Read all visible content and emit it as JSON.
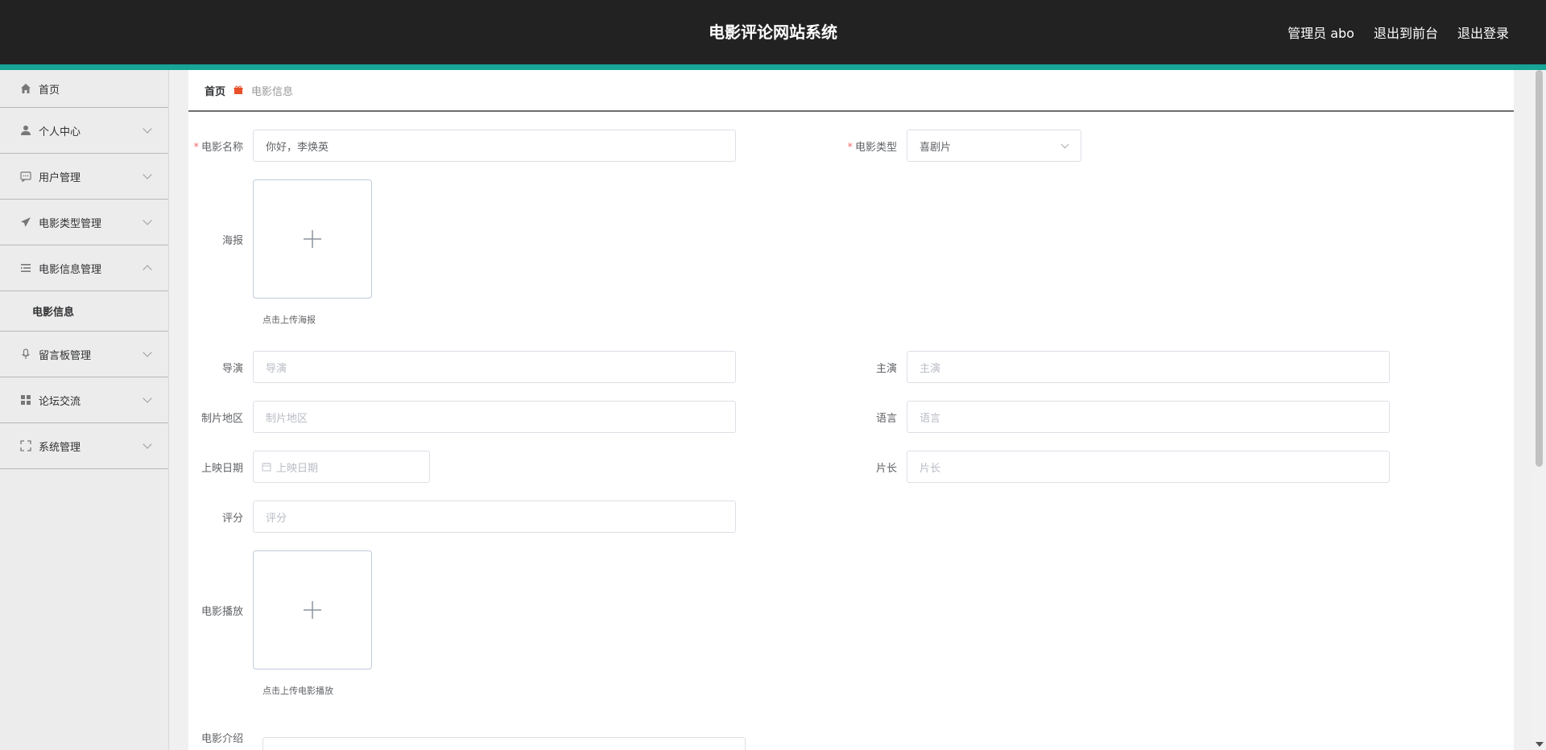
{
  "header": {
    "title": "电影评论网站系统",
    "user": "管理员 abo",
    "front_link": "退出到前台",
    "logout": "退出登录"
  },
  "sidebar": {
    "items": [
      {
        "label": "首页",
        "icon": "home-icon"
      },
      {
        "label": "个人中心",
        "icon": "user-icon"
      },
      {
        "label": "用户管理",
        "icon": "chat-icon"
      },
      {
        "label": "电影类型管理",
        "icon": "send-icon"
      },
      {
        "label": "电影信息管理",
        "icon": "list-icon",
        "expanded": true
      },
      {
        "label": "留言板管理",
        "icon": "microphone-icon"
      },
      {
        "label": "论坛交流",
        "icon": "grid-icon"
      },
      {
        "label": "系统管理",
        "icon": "fullscreen-icon"
      }
    ],
    "submenu": {
      "label": "电影信息"
    }
  },
  "breadcrumb": {
    "home": "首页",
    "current": "电影信息"
  },
  "form": {
    "name": {
      "label": "电影名称",
      "value": "你好，李焕英"
    },
    "type": {
      "label": "电影类型",
      "value": "喜剧片"
    },
    "poster": {
      "label": "海报",
      "hint": "点击上传海报"
    },
    "director": {
      "label": "导演",
      "placeholder": "导演"
    },
    "actor": {
      "label": "主演",
      "placeholder": "主演"
    },
    "region": {
      "label": "制片地区",
      "placeholder": "制片地区"
    },
    "language": {
      "label": "语言",
      "placeholder": "语言"
    },
    "date": {
      "label": "上映日期",
      "placeholder": "上映日期"
    },
    "length": {
      "label": "片长",
      "placeholder": "片长"
    },
    "score": {
      "label": "评分",
      "placeholder": "评分"
    },
    "video": {
      "label": "电影播放",
      "hint": "点击上传电影播放"
    },
    "intro": {
      "label": "电影介绍"
    }
  },
  "colors": {
    "header_bg": "#222222",
    "accent": "#16a596",
    "required": "#f56c6c"
  }
}
